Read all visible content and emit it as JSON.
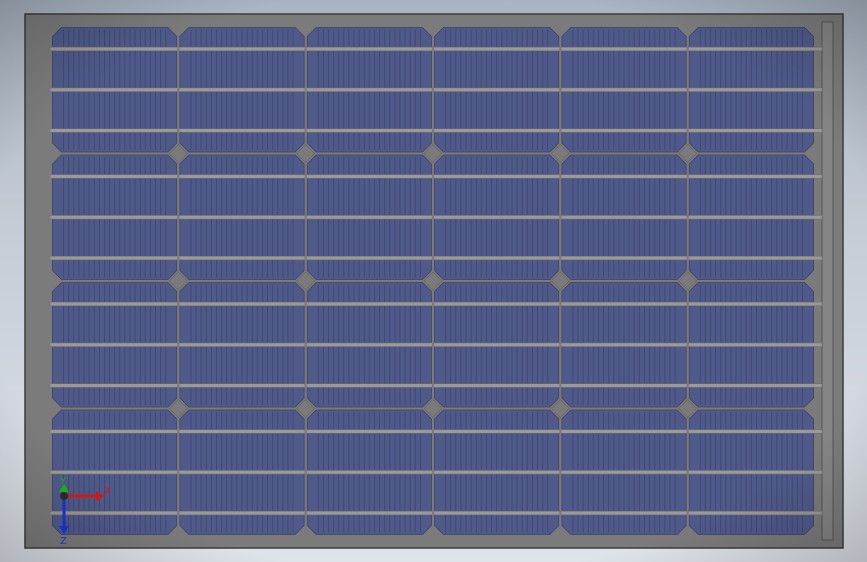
{
  "app": {
    "view": "model-viewport"
  },
  "model": {
    "type": "solar-panel",
    "cell_columns": 6,
    "cell_rows": 4,
    "colors": {
      "background_top": "#a9b3c2",
      "background_bottom": "#dfe3ea",
      "frame": "#7b7b7b",
      "frame_edge": "#3c3c3c",
      "cell": "#505a8a",
      "finger_line": "#3f4870",
      "busbar": "#9a9a9a",
      "grid_gap": "#7a7a7a"
    }
  },
  "triad": {
    "x_label": "X",
    "y_label": "Y",
    "z_label": "Z",
    "colors": {
      "x": "#d01818",
      "y": "#18b018",
      "z": "#1830c8"
    }
  }
}
